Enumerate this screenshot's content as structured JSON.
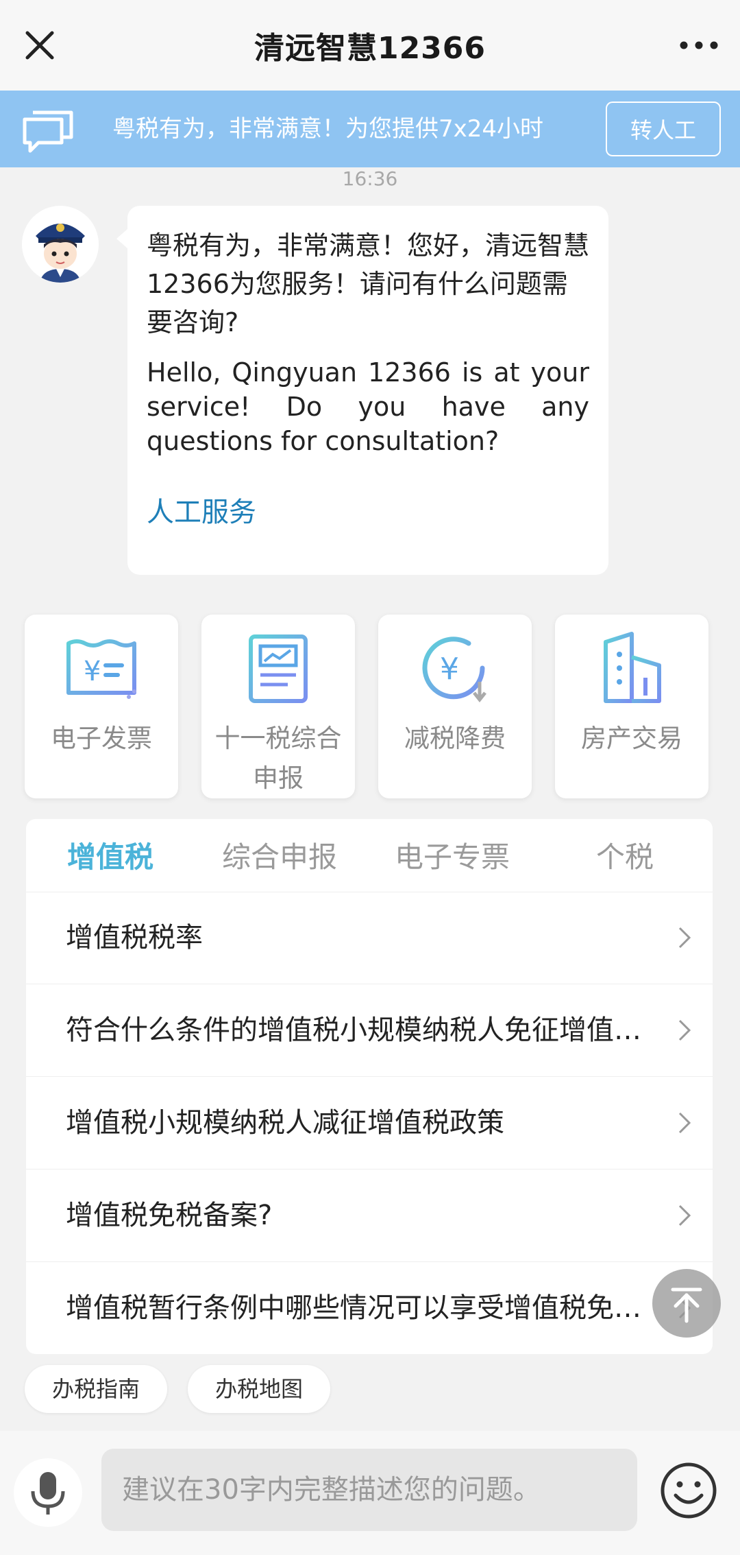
{
  "header": {
    "title": "清远智慧12366"
  },
  "notice": {
    "text": "粤税有为，非常满意！为您提供7x24小时",
    "transfer_label": "转人工"
  },
  "chat": {
    "time": "16:36",
    "message_zh": "粤税有为，非常满意！您好，清远智慧12366为您服务！请问有什么问题需要咨询?",
    "message_en": "Hello, Qingyuan 12366 is at your service! Do you have any questions for consultation?",
    "link_label": "人工服务"
  },
  "services": [
    {
      "label": "电子发票",
      "icon": "invoice-icon"
    },
    {
      "label": "十一税综合申报",
      "icon": "tax-report-icon"
    },
    {
      "label": "减税降费",
      "icon": "tax-reduction-icon"
    },
    {
      "label": "房产交易",
      "icon": "building-icon"
    }
  ],
  "tabs": [
    {
      "label": "增值税",
      "active": true
    },
    {
      "label": "综合申报",
      "active": false
    },
    {
      "label": "电子专票",
      "active": false
    },
    {
      "label": "个税",
      "active": false
    }
  ],
  "questions": [
    "增值税税率",
    "符合什么条件的增值税小规模纳税人免征增值税?",
    "增值税小规模纳税人减征增值税政策",
    "增值税免税备案?",
    "增值税暂行条例中哪些情况可以享受增值税免税?"
  ],
  "chips": [
    "办税指南",
    "办税地图"
  ],
  "input": {
    "placeholder": "建议在30字内完整描述您的问题。"
  },
  "colors": {
    "accent": "#4bb3d9",
    "notice_bg": "#8fc4f2",
    "link": "#1e7fb8"
  }
}
